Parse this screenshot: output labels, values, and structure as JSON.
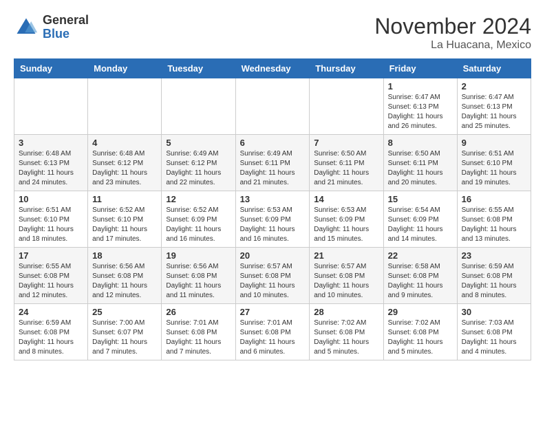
{
  "logo": {
    "general": "General",
    "blue": "Blue"
  },
  "header": {
    "month": "November 2024",
    "location": "La Huacana, Mexico"
  },
  "days_of_week": [
    "Sunday",
    "Monday",
    "Tuesday",
    "Wednesday",
    "Thursday",
    "Friday",
    "Saturday"
  ],
  "weeks": [
    [
      {
        "day": "",
        "info": ""
      },
      {
        "day": "",
        "info": ""
      },
      {
        "day": "",
        "info": ""
      },
      {
        "day": "",
        "info": ""
      },
      {
        "day": "",
        "info": ""
      },
      {
        "day": "1",
        "info": "Sunrise: 6:47 AM\nSunset: 6:13 PM\nDaylight: 11 hours and 26 minutes."
      },
      {
        "day": "2",
        "info": "Sunrise: 6:47 AM\nSunset: 6:13 PM\nDaylight: 11 hours and 25 minutes."
      }
    ],
    [
      {
        "day": "3",
        "info": "Sunrise: 6:48 AM\nSunset: 6:13 PM\nDaylight: 11 hours and 24 minutes."
      },
      {
        "day": "4",
        "info": "Sunrise: 6:48 AM\nSunset: 6:12 PM\nDaylight: 11 hours and 23 minutes."
      },
      {
        "day": "5",
        "info": "Sunrise: 6:49 AM\nSunset: 6:12 PM\nDaylight: 11 hours and 22 minutes."
      },
      {
        "day": "6",
        "info": "Sunrise: 6:49 AM\nSunset: 6:11 PM\nDaylight: 11 hours and 21 minutes."
      },
      {
        "day": "7",
        "info": "Sunrise: 6:50 AM\nSunset: 6:11 PM\nDaylight: 11 hours and 21 minutes."
      },
      {
        "day": "8",
        "info": "Sunrise: 6:50 AM\nSunset: 6:11 PM\nDaylight: 11 hours and 20 minutes."
      },
      {
        "day": "9",
        "info": "Sunrise: 6:51 AM\nSunset: 6:10 PM\nDaylight: 11 hours and 19 minutes."
      }
    ],
    [
      {
        "day": "10",
        "info": "Sunrise: 6:51 AM\nSunset: 6:10 PM\nDaylight: 11 hours and 18 minutes."
      },
      {
        "day": "11",
        "info": "Sunrise: 6:52 AM\nSunset: 6:10 PM\nDaylight: 11 hours and 17 minutes."
      },
      {
        "day": "12",
        "info": "Sunrise: 6:52 AM\nSunset: 6:09 PM\nDaylight: 11 hours and 16 minutes."
      },
      {
        "day": "13",
        "info": "Sunrise: 6:53 AM\nSunset: 6:09 PM\nDaylight: 11 hours and 16 minutes."
      },
      {
        "day": "14",
        "info": "Sunrise: 6:53 AM\nSunset: 6:09 PM\nDaylight: 11 hours and 15 minutes."
      },
      {
        "day": "15",
        "info": "Sunrise: 6:54 AM\nSunset: 6:09 PM\nDaylight: 11 hours and 14 minutes."
      },
      {
        "day": "16",
        "info": "Sunrise: 6:55 AM\nSunset: 6:08 PM\nDaylight: 11 hours and 13 minutes."
      }
    ],
    [
      {
        "day": "17",
        "info": "Sunrise: 6:55 AM\nSunset: 6:08 PM\nDaylight: 11 hours and 12 minutes."
      },
      {
        "day": "18",
        "info": "Sunrise: 6:56 AM\nSunset: 6:08 PM\nDaylight: 11 hours and 12 minutes."
      },
      {
        "day": "19",
        "info": "Sunrise: 6:56 AM\nSunset: 6:08 PM\nDaylight: 11 hours and 11 minutes."
      },
      {
        "day": "20",
        "info": "Sunrise: 6:57 AM\nSunset: 6:08 PM\nDaylight: 11 hours and 10 minutes."
      },
      {
        "day": "21",
        "info": "Sunrise: 6:57 AM\nSunset: 6:08 PM\nDaylight: 11 hours and 10 minutes."
      },
      {
        "day": "22",
        "info": "Sunrise: 6:58 AM\nSunset: 6:08 PM\nDaylight: 11 hours and 9 minutes."
      },
      {
        "day": "23",
        "info": "Sunrise: 6:59 AM\nSunset: 6:08 PM\nDaylight: 11 hours and 8 minutes."
      }
    ],
    [
      {
        "day": "24",
        "info": "Sunrise: 6:59 AM\nSunset: 6:08 PM\nDaylight: 11 hours and 8 minutes."
      },
      {
        "day": "25",
        "info": "Sunrise: 7:00 AM\nSunset: 6:07 PM\nDaylight: 11 hours and 7 minutes."
      },
      {
        "day": "26",
        "info": "Sunrise: 7:01 AM\nSunset: 6:08 PM\nDaylight: 11 hours and 7 minutes."
      },
      {
        "day": "27",
        "info": "Sunrise: 7:01 AM\nSunset: 6:08 PM\nDaylight: 11 hours and 6 minutes."
      },
      {
        "day": "28",
        "info": "Sunrise: 7:02 AM\nSunset: 6:08 PM\nDaylight: 11 hours and 5 minutes."
      },
      {
        "day": "29",
        "info": "Sunrise: 7:02 AM\nSunset: 6:08 PM\nDaylight: 11 hours and 5 minutes."
      },
      {
        "day": "30",
        "info": "Sunrise: 7:03 AM\nSunset: 6:08 PM\nDaylight: 11 hours and 4 minutes."
      }
    ]
  ]
}
